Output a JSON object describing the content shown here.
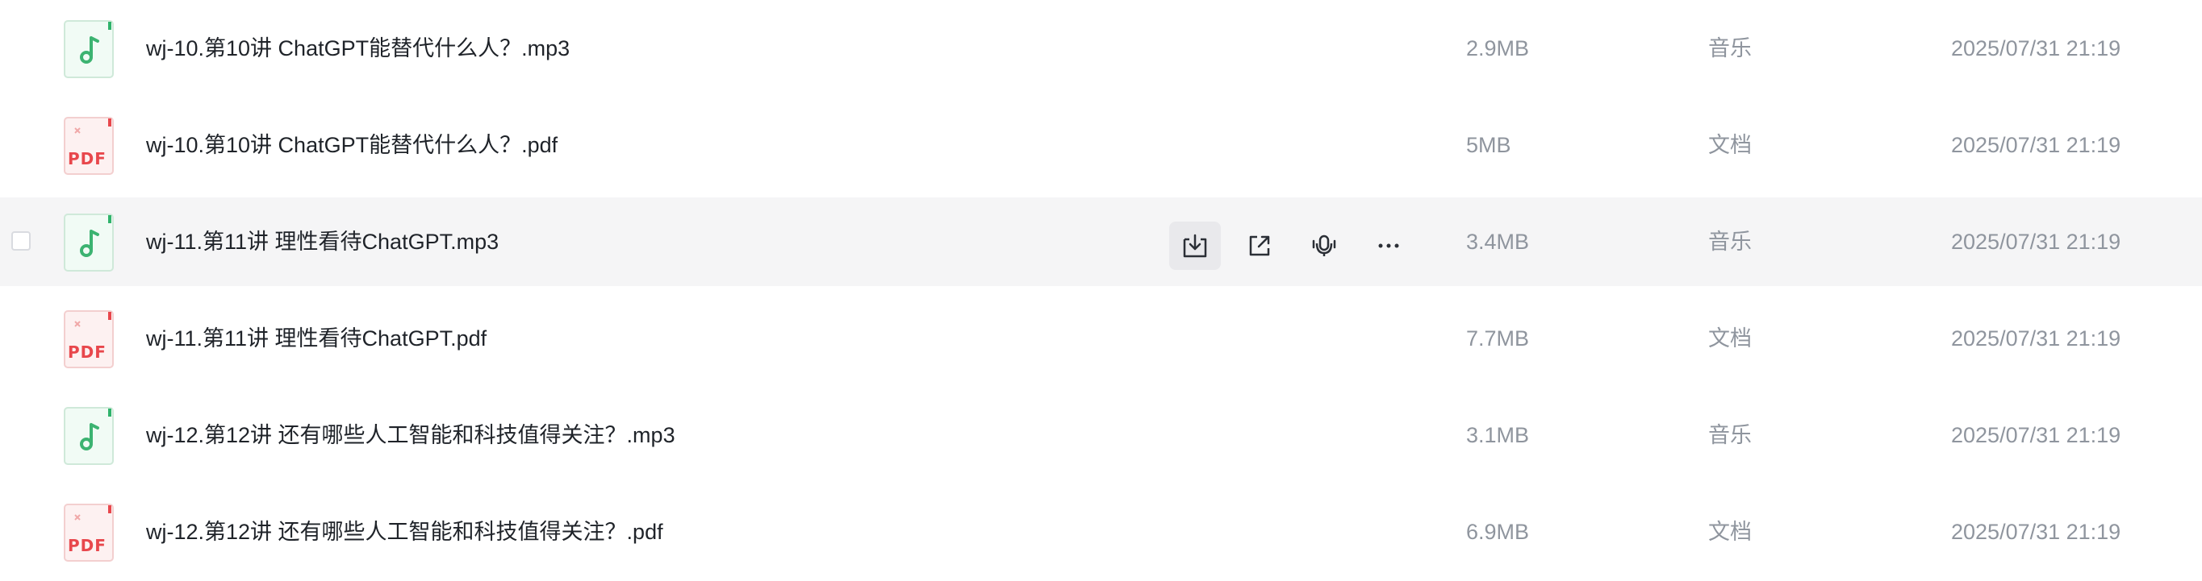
{
  "files": [
    {
      "name": "wj-10.第10讲 ChatGPT能替代什么人？.mp3",
      "size": "2.9MB",
      "type": "音乐",
      "date": "2025/07/31 21:19",
      "icon": "music-file-icon"
    },
    {
      "name": "wj-10.第10讲 ChatGPT能替代什么人？.pdf",
      "size": "5MB",
      "type": "文档",
      "date": "2025/07/31 21:19",
      "icon": "pdf-file-icon"
    },
    {
      "name": "wj-11.第11讲 理性看待ChatGPT.mp3",
      "size": "3.4MB",
      "type": "音乐",
      "date": "2025/07/31 21:19",
      "icon": "music-file-icon"
    },
    {
      "name": "wj-11.第11讲 理性看待ChatGPT.pdf",
      "size": "7.7MB",
      "type": "文档",
      "date": "2025/07/31 21:19",
      "icon": "pdf-file-icon"
    },
    {
      "name": "wj-12.第12讲 还有哪些人工智能和科技值得关注？.mp3",
      "size": "3.1MB",
      "type": "音乐",
      "date": "2025/07/31 21:19",
      "icon": "music-file-icon"
    },
    {
      "name": "wj-12.第12讲 还有哪些人工智能和科技值得关注？.pdf",
      "size": "6.9MB",
      "type": "文档",
      "date": "2025/07/31 21:19",
      "icon": "pdf-file-icon"
    }
  ],
  "pdf_icon_label": "PDF",
  "row_actions": [
    "download-icon",
    "share-icon",
    "listen-icon",
    "more-icon"
  ],
  "colors": {
    "hover_row": "#f5f5f6",
    "music_icon": "#3cb371",
    "pdf_icon": "#e8474c",
    "text": "#1f2329",
    "muted_text": "#8f959e"
  }
}
